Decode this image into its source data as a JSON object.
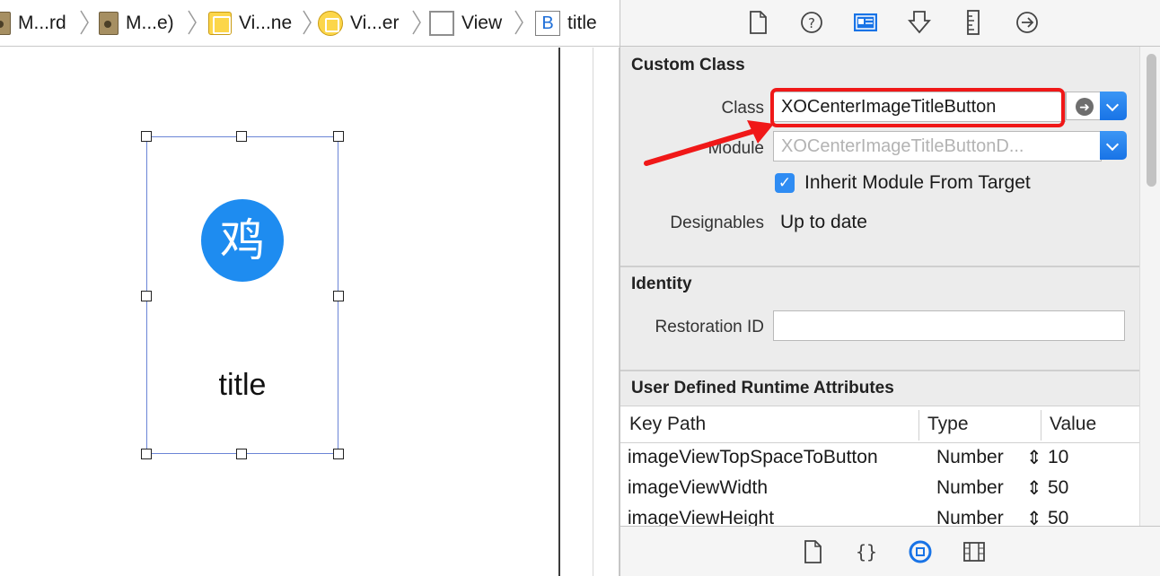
{
  "breadcrumbs": [
    {
      "label": "M...rd",
      "icon": "storyboard-file-icon"
    },
    {
      "label": "M...e)",
      "icon": "storyboard-base-icon"
    },
    {
      "label": "Vi...ne",
      "icon": "scene-icon"
    },
    {
      "label": "Vi...er",
      "icon": "view-controller-icon"
    },
    {
      "label": "View",
      "icon": "view-icon"
    },
    {
      "label": "title",
      "icon": "button-icon",
      "icon_glyph": "B"
    }
  ],
  "canvas": {
    "avatar_glyph": "鸡",
    "button_title": "title"
  },
  "inspector": {
    "tabs": [
      "file-inspector-icon",
      "quick-help-icon",
      "identity-inspector-icon",
      "attributes-inspector-icon",
      "size-inspector-icon",
      "connections-inspector-icon"
    ],
    "custom_class": {
      "title": "Custom Class",
      "class_label": "Class",
      "class_value": "XOCenterImageTitleButton",
      "module_label": "Module",
      "module_placeholder": "XOCenterImageTitleButtonD...",
      "inherit_label": "Inherit Module From Target",
      "inherit_checked": true,
      "designables_label": "Designables",
      "designables_value": "Up to date"
    },
    "identity": {
      "title": "Identity",
      "restoration_label": "Restoration ID",
      "restoration_value": ""
    },
    "runtime_attributes": {
      "title": "User Defined Runtime Attributes",
      "columns": [
        "Key Path",
        "Type",
        "Value"
      ],
      "rows": [
        {
          "key": "imageViewTopSpaceToButton",
          "type": "Number",
          "value": "10"
        },
        {
          "key": "imageViewWidth",
          "type": "Number",
          "value": "50"
        },
        {
          "key": "imageViewHeight",
          "type": "Number",
          "value": "50"
        }
      ]
    },
    "library_tabs": [
      "file-template-icon",
      "code-snippet-icon",
      "object-library-icon",
      "media-library-icon"
    ]
  },
  "colors": {
    "accent": "#1873e6",
    "annotation": "#f01818",
    "avatar": "#1e8cf0",
    "selection": "#6b85d6"
  }
}
